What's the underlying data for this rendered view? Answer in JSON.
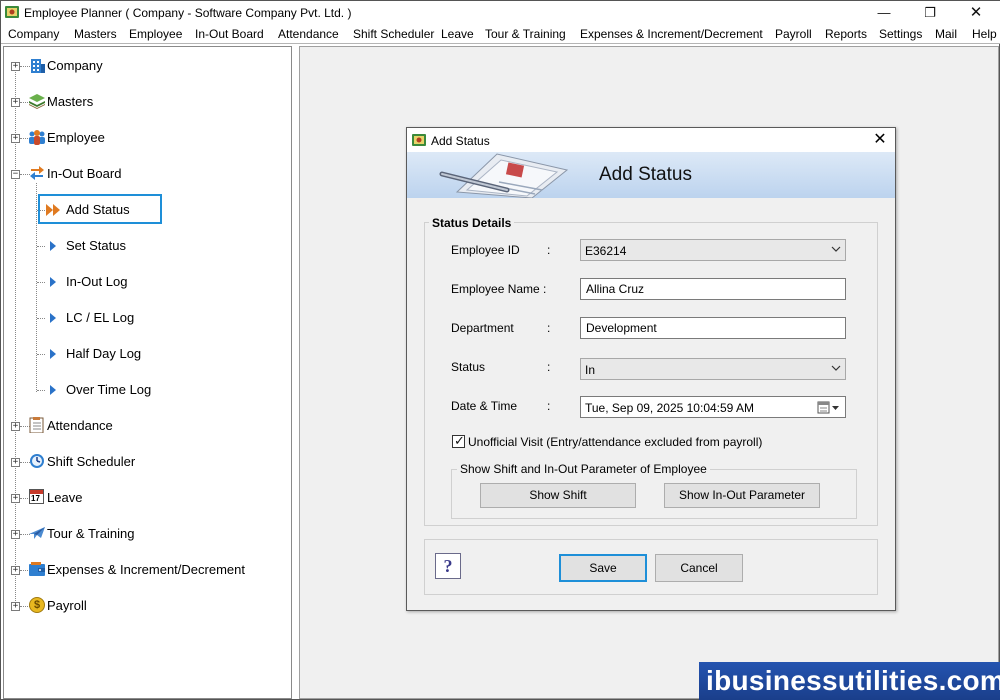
{
  "window": {
    "title": "Employee Planner ( Company - Software Company Pvt. Ltd. )",
    "minimize_symbol": "—",
    "maximize_symbol": "❐",
    "close_symbol": "✕"
  },
  "menu": [
    "Company",
    "Masters",
    "Employee",
    "In-Out Board",
    "Attendance",
    "Shift Scheduler",
    "Leave",
    "Tour & Training",
    "Expenses & Increment/Decrement",
    "Payroll",
    "Reports",
    "Settings",
    "Mail",
    "Help"
  ],
  "tree": {
    "top_items": [
      {
        "label": "Company",
        "icon": "building-icon"
      },
      {
        "label": "Masters",
        "icon": "layers-icon"
      },
      {
        "label": "Employee",
        "icon": "people-icon"
      },
      {
        "label": "In-Out Board",
        "icon": "exchange-arrows-icon"
      },
      {
        "label": "Attendance",
        "icon": "checklist-icon"
      },
      {
        "label": "Shift Scheduler",
        "icon": "clock-icon"
      },
      {
        "label": "Leave",
        "icon": "calendar-icon",
        "calendar_day": "17"
      },
      {
        "label": "Tour & Training",
        "icon": "airplane-icon"
      },
      {
        "label": "Expenses & Increment/Decrement",
        "icon": "wallet-icon"
      },
      {
        "label": "Payroll",
        "icon": "coin-icon",
        "coin_symbol": "$"
      }
    ],
    "in_out_children": [
      {
        "label": "Add Status",
        "selected": true
      },
      {
        "label": "Set Status"
      },
      {
        "label": "In-Out Log"
      },
      {
        "label": "LC / EL Log"
      },
      {
        "label": "Half Day Log"
      },
      {
        "label": "Over Time Log"
      }
    ],
    "expander_collapsed": "+",
    "expander_expanded": "−"
  },
  "dialog": {
    "title": "Add Status",
    "close_symbol": "✕",
    "banner_title": "Add Status",
    "group_title": "Status Details",
    "fields": {
      "employee_id": {
        "label": "Employee ID",
        "value": "E36214"
      },
      "employee_name": {
        "label": "Employee Name :",
        "value": "Allina Cruz"
      },
      "department": {
        "label": "Department",
        "value": "Development"
      },
      "status": {
        "label": "Status",
        "value": "In"
      },
      "date_time": {
        "label": "Date & Time",
        "value": "Tue, Sep 09, 2025 10:04:59 AM"
      }
    },
    "colon": ":",
    "unofficial_visit": {
      "label": "Unofficial Visit (Entry/attendance excluded from payroll)",
      "checked": true,
      "check_mark": "✓"
    },
    "shift_group_title": "Show Shift and In-Out Parameter of Employee",
    "show_shift_button": "Show Shift",
    "show_inout_button": "Show In-Out Parameter",
    "help_symbol": "?",
    "save_button": "Save",
    "cancel_button": "Cancel"
  },
  "watermark": "ibusinessutilities.com",
  "colors": {
    "selection_border": "#1e8fd8",
    "tree_arrow": "#2a72c8",
    "banner_top": "#dde9f7",
    "banner_bottom": "#bcd3ee",
    "watermark_bg": "#2454b0"
  }
}
